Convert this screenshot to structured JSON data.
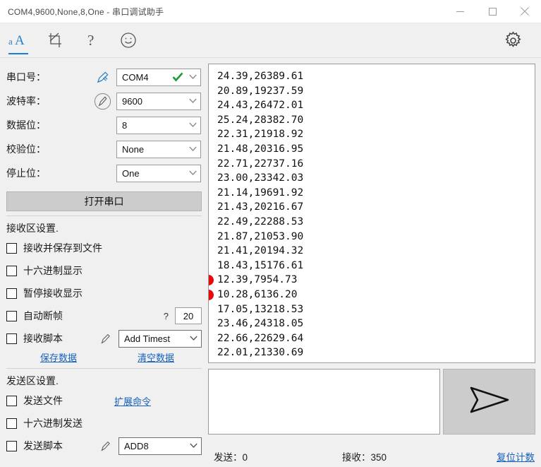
{
  "window": {
    "title": "COM4,9600,None,8,One - 串口调试助手",
    "minimize_label": "minimize",
    "maximize_label": "maximize",
    "close_label": "close"
  },
  "toolbar": {
    "items": [
      {
        "name": "font-size-icon",
        "label": "aA",
        "active": true
      },
      {
        "name": "crop-icon",
        "label": "crop",
        "active": false
      },
      {
        "name": "help-icon",
        "label": "?",
        "active": false
      },
      {
        "name": "emoji-icon",
        "label": "emoji",
        "active": false
      }
    ],
    "settings_label": "settings"
  },
  "port_settings": {
    "rows": [
      {
        "label": "串口号：",
        "value": "COM4",
        "has_check": true,
        "icon": "pen-blue-icon"
      },
      {
        "label": "波特率：",
        "value": "9600",
        "has_check": false,
        "icon": "pen-circle-icon"
      },
      {
        "label": "数据位：",
        "value": "8",
        "has_check": false,
        "icon": "none"
      },
      {
        "label": "校验位：",
        "value": "None",
        "has_check": false,
        "icon": "none"
      },
      {
        "label": "停止位：",
        "value": "One",
        "has_check": false,
        "icon": "none"
      }
    ],
    "open_button": "打开串口"
  },
  "receive_settings": {
    "title": "接收区设置.",
    "checkboxes": [
      {
        "label": "接收并保存到文件",
        "checked": false
      },
      {
        "label": "十六进制显示",
        "checked": false
      },
      {
        "label": "暂停接收显示",
        "checked": false
      }
    ],
    "auto_frame": {
      "label": "自动断帧",
      "checked": false,
      "hint": "?",
      "value": "20"
    },
    "recv_script": {
      "label": "接收脚本",
      "checked": false,
      "dropdown_value": "Add Timest"
    },
    "links": {
      "save": "保存数据",
      "clear": "清空数据"
    }
  },
  "send_settings": {
    "title": "发送区设置.",
    "checkboxes": [
      {
        "label": "发送文件",
        "checked": false
      },
      {
        "label": "十六进制发送",
        "checked": false
      }
    ],
    "send_script": {
      "label": "发送脚本",
      "checked": false,
      "dropdown_value": "ADD8"
    },
    "extend_link": "扩展命令"
  },
  "receive_area": {
    "lines": [
      "24.39,26389.61",
      "20.89,19237.59",
      "24.43,26472.01",
      "25.24,28382.70",
      "22.31,21918.92",
      "21.48,20316.95",
      "22.71,22737.16",
      "23.00,23342.03",
      "21.14,19691.92",
      "21.43,20216.67",
      "22.49,22288.53",
      "21.87,21053.90",
      "21.41,20194.32",
      "18.43,15176.61",
      "12.39,7954.73",
      "10.28,6136.20",
      "17.05,13218.53",
      "23.46,24318.05",
      "22.66,22629.64",
      "22.01,21330.69"
    ],
    "annotation_dot_color": "#e8090c",
    "annotated_line_indexes": [
      14,
      15
    ]
  },
  "send_area": {
    "input_value": "",
    "send_button_label": "send"
  },
  "statusbar": {
    "sent": "发送：0",
    "received": "接收：350",
    "reset_link": "复位计数"
  }
}
